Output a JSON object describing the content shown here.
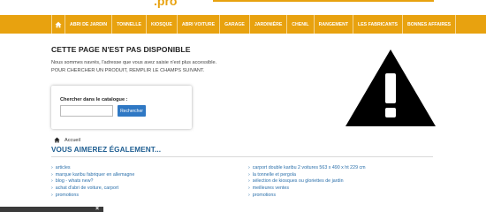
{
  "header": {
    "logo_fragment": ".pro"
  },
  "nav": {
    "home_icon": "home-icon",
    "items": [
      {
        "label": "ABRI DE JARDIN"
      },
      {
        "label": "TONNELLE"
      },
      {
        "label": "KIOSQUE"
      },
      {
        "label": "ABRI VOITURE"
      },
      {
        "label": "GARAGE"
      },
      {
        "label": "JARDINIÈRE"
      },
      {
        "label": "CHENIL"
      },
      {
        "label": "RANGEMENT"
      },
      {
        "label": "LES FABRICANTS"
      },
      {
        "label": "BONNES AFFAIRES"
      }
    ]
  },
  "error": {
    "title": "CETTE PAGE N'EST PAS DISPONIBLE",
    "message1": "Nous sommes navrés, l'adresse que vous avez saisie n'est plus accessible.",
    "message2": "Pour chercher un produit, remplir le champs suivant."
  },
  "warning_icon": "warning-triangle-icon",
  "search": {
    "label": "Chercher dans le catalogue :",
    "value": "",
    "button_label": "Rechercher"
  },
  "breadcrumb": {
    "home_icon": "home-icon",
    "label": "Accueil"
  },
  "also_like": {
    "title": "VOUS AIMEREZ ÉGALEMENT...",
    "left_links": [
      {
        "label": "articles"
      },
      {
        "label": "marque karibu fabriquer en allemagne"
      },
      {
        "label": "blog - whats new?"
      },
      {
        "label": "achat d'abri de voiture, carport"
      },
      {
        "label": "promotions"
      }
    ],
    "right_links": [
      {
        "label": "carport double karibu 2 voitures 563 x 490 x ht 229 cm"
      },
      {
        "label": "la tonnelle et pergola"
      },
      {
        "label": "sélection de kiosques ou gloriettes de jardin"
      },
      {
        "label": "meilleures ventes"
      },
      {
        "label": "promotions"
      }
    ]
  },
  "colors": {
    "accent": "#e8a20f",
    "link": "#2a6faa",
    "heading_blue": "#1f5e91",
    "button_blue": "#2f78c4"
  },
  "bottom_bar": {
    "close_glyph": "×"
  }
}
